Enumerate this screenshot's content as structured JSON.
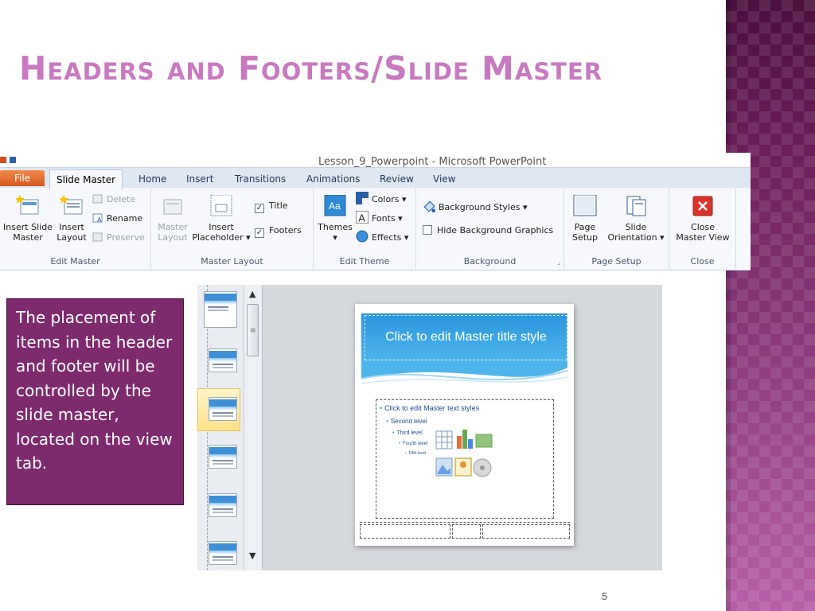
{
  "slide": {
    "title": "Headers and Footers/Slide Master",
    "page_number": "5",
    "callout": "The placement of items in the header and footer will be controlled by the slide master, located on the view tab."
  },
  "ribbon": {
    "app_title": "Lesson_9_Powerpoint  -  Microsoft PowerPoint",
    "tabs": [
      {
        "label": "File"
      },
      {
        "label": "Slide Master"
      },
      {
        "label": "Home"
      },
      {
        "label": "Insert"
      },
      {
        "label": "Transitions"
      },
      {
        "label": "Animations"
      },
      {
        "label": "Review"
      },
      {
        "label": "View"
      }
    ],
    "edit_master": {
      "label": "Edit Master",
      "insert_slide_master": [
        "Insert Slide",
        "Master"
      ],
      "insert_layout": [
        "Insert",
        "Layout"
      ],
      "delete": "Delete",
      "rename": "Rename",
      "preserve": "Preserve"
    },
    "master_layout": {
      "label": "Master Layout",
      "master_layout_btn": [
        "Master",
        "Layout"
      ],
      "insert_placeholder": [
        "Insert",
        "Placeholder ▾"
      ],
      "title": "Title",
      "footers": "Footers"
    },
    "edit_theme": {
      "label": "Edit Theme",
      "themes": "Themes",
      "colors": "Colors ▾",
      "fonts": "Fonts ▾",
      "effects": "Effects ▾"
    },
    "background": {
      "label": "Background",
      "background_styles": "Background Styles ▾",
      "hide_background_graphics": "Hide Background Graphics"
    },
    "page_setup": {
      "label": "Page Setup",
      "page_setup_btn": [
        "Page",
        "Setup"
      ],
      "slide_orientation": [
        "Slide",
        "Orientation ▾"
      ]
    },
    "close": {
      "label": "Close",
      "close_master_view": [
        "Close",
        "Master View"
      ]
    }
  },
  "editor": {
    "master_title": "Click to edit Master title style",
    "levels": [
      "Click to edit Master text styles",
      "Second level",
      "Third level",
      "Fourth level",
      "Fifth level"
    ]
  },
  "colors": {
    "title": "#c879bf",
    "callout_bg": "#7e2a6e",
    "banner": "#2a96de"
  }
}
